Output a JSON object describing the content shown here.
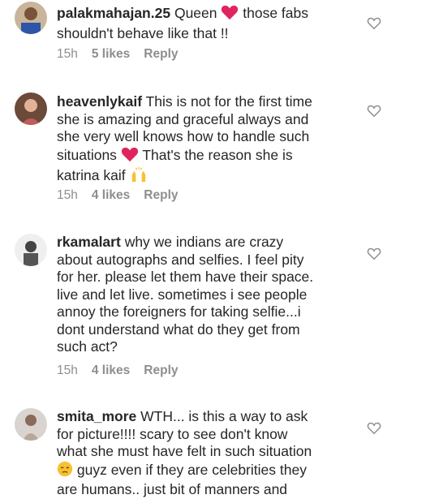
{
  "comments": [
    {
      "username": "palakmahajan.25",
      "lines": [
        "Queen",
        " those fabs",
        "shouldn't behave like that !!"
      ],
      "time": "15h",
      "likes": "5 likes",
      "reply": "Reply"
    },
    {
      "username": "heavenlykaif",
      "lines": [
        "This is not for the first time",
        "she is amazing and graceful always and",
        "she very well knows how to handle such",
        "situations",
        "That's the reason she is",
        "katrina kaif"
      ],
      "time": "15h",
      "likes": "4 likes",
      "reply": "Reply"
    },
    {
      "username": "rkamalart",
      "lines": [
        "why we indians are crazy",
        "about autographs and selfies. I feel pity",
        "for her. please let them have their space.",
        "live and let live. sometimes i see people",
        "annoy the foreigners for taking selfie...i",
        "dont understand what do they get from",
        "such act?"
      ],
      "time": "15h",
      "likes": "4 likes",
      "reply": "Reply"
    },
    {
      "username": "smita_more",
      "lines": [
        "WTH... is this a way to ask",
        "for picture!!!! scary to see don't know",
        "what she must have felt in such situation",
        "guyz even if they are celebrities they",
        "are humans.. just bit of manners and"
      ]
    }
  ],
  "colors": {
    "text": "#262626",
    "meta": "#8e8e8e",
    "heart_emoji": "#e0245e",
    "hands_emoji": "#f7c12f",
    "face_emoji": "#f7c12f"
  },
  "icons": {
    "like": "heart-outline-icon",
    "emoji_heart": "red-heart-emoji",
    "emoji_hands": "raising-hands-emoji",
    "emoji_face": "unamused-face-emoji"
  }
}
